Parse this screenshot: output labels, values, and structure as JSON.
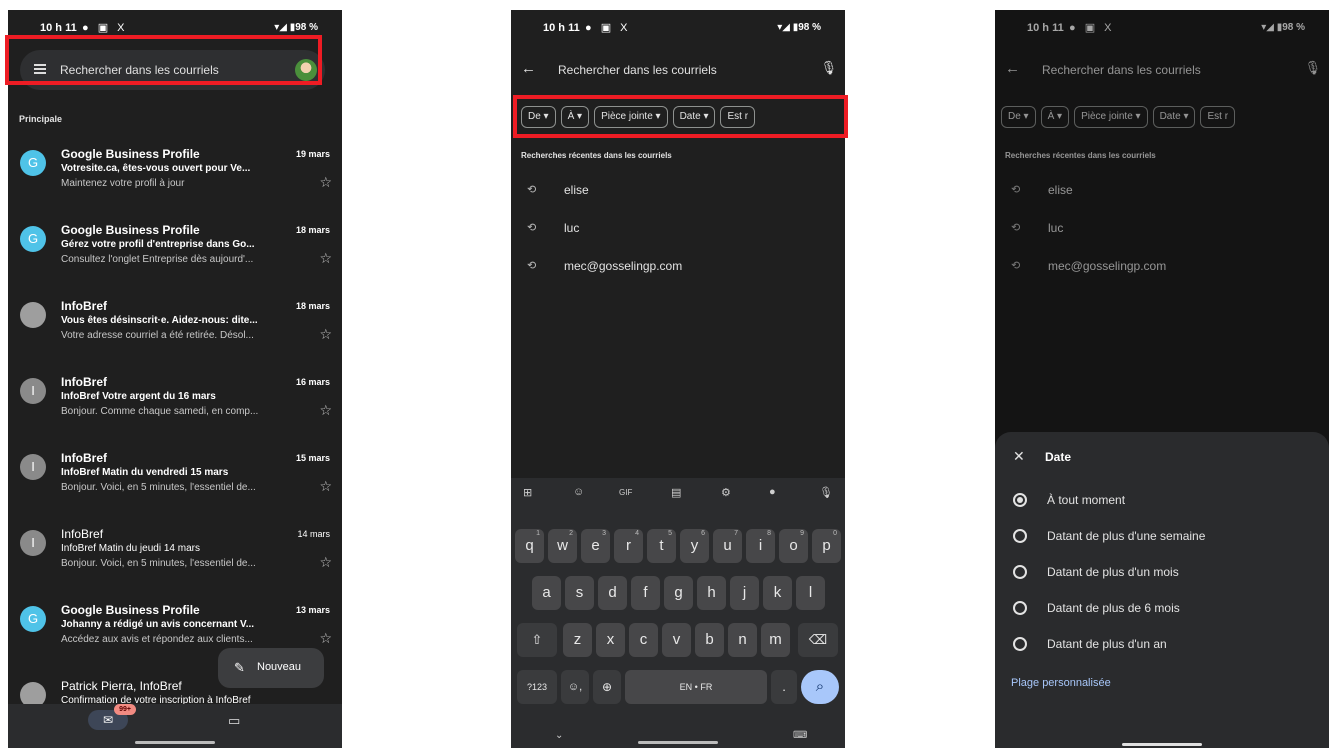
{
  "status": {
    "time": "10 h 11",
    "icons": "● ▣ X",
    "battery": "▾◢ ▮98 %"
  },
  "inbox": {
    "search_placeholder": "Rechercher dans les courriels",
    "section": "Principale",
    "emails": [
      {
        "avatar": "G",
        "avatar_color": "#4fc3e8",
        "sender": "Google Business Profile",
        "date": "19 mars",
        "subject": "Votresite.ca, êtes-vous ouvert pour Ve...",
        "snippet": "Maintenez votre profil à jour",
        "unread": true
      },
      {
        "avatar": "G",
        "avatar_color": "#4fc3e8",
        "sender": "Google Business Profile",
        "date": "18 mars",
        "subject": "Gérez votre profil d'entreprise dans Go...",
        "snippet": "Consultez l'onglet Entreprise dès aujourd'...",
        "unread": true
      },
      {
        "avatar": "",
        "avatar_color": "#9e9e9e",
        "sender": "InfoBref",
        "date": "18 mars",
        "subject": "Vous êtes désinscrit·e. Aidez-nous: dite...",
        "snippet": "Votre adresse courriel a été retirée. Désol...",
        "unread": true
      },
      {
        "avatar": "I",
        "avatar_color": "#8a8a8a",
        "sender": "InfoBref",
        "date": "16 mars",
        "subject": "InfoBref Votre argent du 16 mars",
        "snippet": "Bonjour. Comme chaque samedi, en comp...",
        "unread": true
      },
      {
        "avatar": "I",
        "avatar_color": "#8a8a8a",
        "sender": "InfoBref",
        "date": "15 mars",
        "subject": "InfoBref Matin du vendredi 15 mars",
        "snippet": "Bonjour. Voici, en 5 minutes, l'essentiel de...",
        "unread": true
      },
      {
        "avatar": "I",
        "avatar_color": "#8a8a8a",
        "sender": "InfoBref",
        "date": "14 mars",
        "subject": "InfoBref Matin du jeudi 14 mars",
        "snippet": "Bonjour. Voici, en 5 minutes, l'essentiel de...",
        "unread": false
      },
      {
        "avatar": "G",
        "avatar_color": "#4fc3e8",
        "sender": "Google Business Profile",
        "date": "13 mars",
        "subject": "Johanny a rédigé un avis concernant V...",
        "snippet": "Accédez aux avis et répondez aux clients...",
        "unread": true
      },
      {
        "avatar": "",
        "avatar_color": "#9e9e9e",
        "sender": "Patrick Pierra, InfoBref",
        "date": "",
        "subject": "Confirmation de votre inscription à InfoBref",
        "snippet": "",
        "unread": false
      }
    ],
    "compose_label": "Nouveau",
    "badge": "99+"
  },
  "search": {
    "placeholder": "Rechercher dans les courriels",
    "chips": [
      "De ▾",
      "À ▾",
      "Pièce jointe ▾",
      "Date ▾",
      "Est r"
    ],
    "recent_title": "Recherches récentes dans les courriels",
    "recent": [
      "elise",
      "luc",
      "mec@gosselingp.com"
    ]
  },
  "keyboard": {
    "row1": [
      "q",
      "w",
      "e",
      "r",
      "t",
      "y",
      "u",
      "i",
      "o",
      "p"
    ],
    "row1_sup": [
      "1",
      "2",
      "3",
      "4",
      "5",
      "6",
      "7",
      "8",
      "9",
      "0"
    ],
    "row2": [
      "a",
      "s",
      "d",
      "f",
      "g",
      "h",
      "j",
      "k",
      "l"
    ],
    "row3": [
      "z",
      "x",
      "c",
      "v",
      "b",
      "n",
      "m"
    ],
    "sym": "?123",
    "lang": "EN • FR",
    "gif": "GIF"
  },
  "date_sheet": {
    "title": "Date",
    "options": [
      "À tout moment",
      "Datant de plus d'une semaine",
      "Datant de plus d'un mois",
      "Datant de plus de 6 mois",
      "Datant de plus d'un an"
    ],
    "selected": 0,
    "custom": "Plage personnalisée"
  }
}
